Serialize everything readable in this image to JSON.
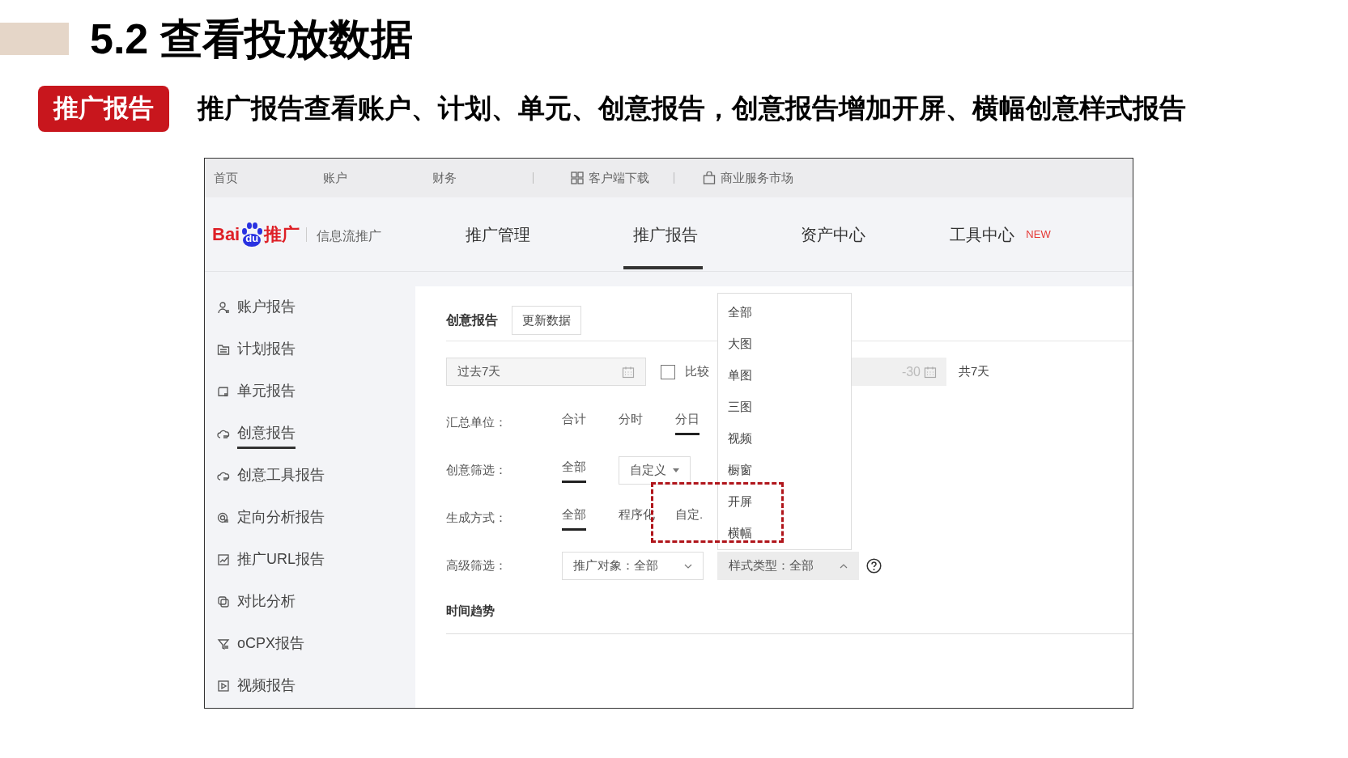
{
  "slide": {
    "title": "5.2 查看投放数据",
    "badge": "推广报告",
    "subtitle": "推广报告查看账户、计划、单元、创意报告，创意报告增加开屏、横幅创意样式报告"
  },
  "top_nav": {
    "links": [
      "首页",
      "账户",
      "财务"
    ],
    "client_download": "客户端下载",
    "market": "商业服务市场"
  },
  "header": {
    "logo": {
      "brand_left": "Bai",
      "brand_paw": "du",
      "brand_right": "推广",
      "product": "信息流推广"
    },
    "tabs": [
      {
        "label": "推广管理",
        "selected": false
      },
      {
        "label": "推广报告",
        "selected": true
      },
      {
        "label": "资产中心",
        "selected": false
      },
      {
        "label": "工具中心",
        "selected": false,
        "badge": "NEW"
      }
    ]
  },
  "sidebar": [
    {
      "label": "账户报告",
      "selected": false
    },
    {
      "label": "计划报告",
      "selected": false
    },
    {
      "label": "单元报告",
      "selected": false
    },
    {
      "label": "创意报告",
      "selected": true
    },
    {
      "label": "创意工具报告",
      "selected": false
    },
    {
      "label": "定向分析报告",
      "selected": false
    },
    {
      "label": "推广URL报告",
      "selected": false
    },
    {
      "label": "对比分析",
      "selected": false
    },
    {
      "label": "oCPX报告",
      "selected": false
    },
    {
      "label": "视频报告",
      "selected": false
    }
  ],
  "report": {
    "title": "创意报告",
    "refresh_button": "更新数据",
    "date_range": "过去7天",
    "compare": {
      "label": "比较",
      "checked": false
    },
    "compare_date_tail": "-30",
    "total_days": "共7天",
    "filters": [
      {
        "label": "汇总单位：",
        "items": [
          {
            "kind": "option",
            "label": "合计",
            "selected": false
          },
          {
            "kind": "option",
            "label": "分时",
            "selected": false
          },
          {
            "kind": "option",
            "label": "分日",
            "selected": true
          }
        ]
      },
      {
        "label": "创意筛选：",
        "items": [
          {
            "kind": "option",
            "label": "全部",
            "selected": true
          },
          {
            "kind": "dropdown",
            "label": "自定义",
            "open": false
          }
        ]
      },
      {
        "label": "生成方式：",
        "items": [
          {
            "kind": "option",
            "label": "全部",
            "selected": true
          },
          {
            "kind": "option",
            "label": "程序化",
            "selected": false
          },
          {
            "kind": "option",
            "label": "自定.",
            "selected": false
          }
        ]
      },
      {
        "label": "高级筛选：",
        "items": [
          {
            "kind": "select",
            "label": "推广对象：全部",
            "open": false
          },
          {
            "kind": "select",
            "label": "样式类型：全部",
            "open": true
          },
          {
            "kind": "help"
          }
        ]
      }
    ],
    "style_menu": [
      "全部",
      "大图",
      "单图",
      "三图",
      "视频",
      "橱窗",
      "开屏",
      "横幅"
    ],
    "trend_title": "时间趋势"
  }
}
